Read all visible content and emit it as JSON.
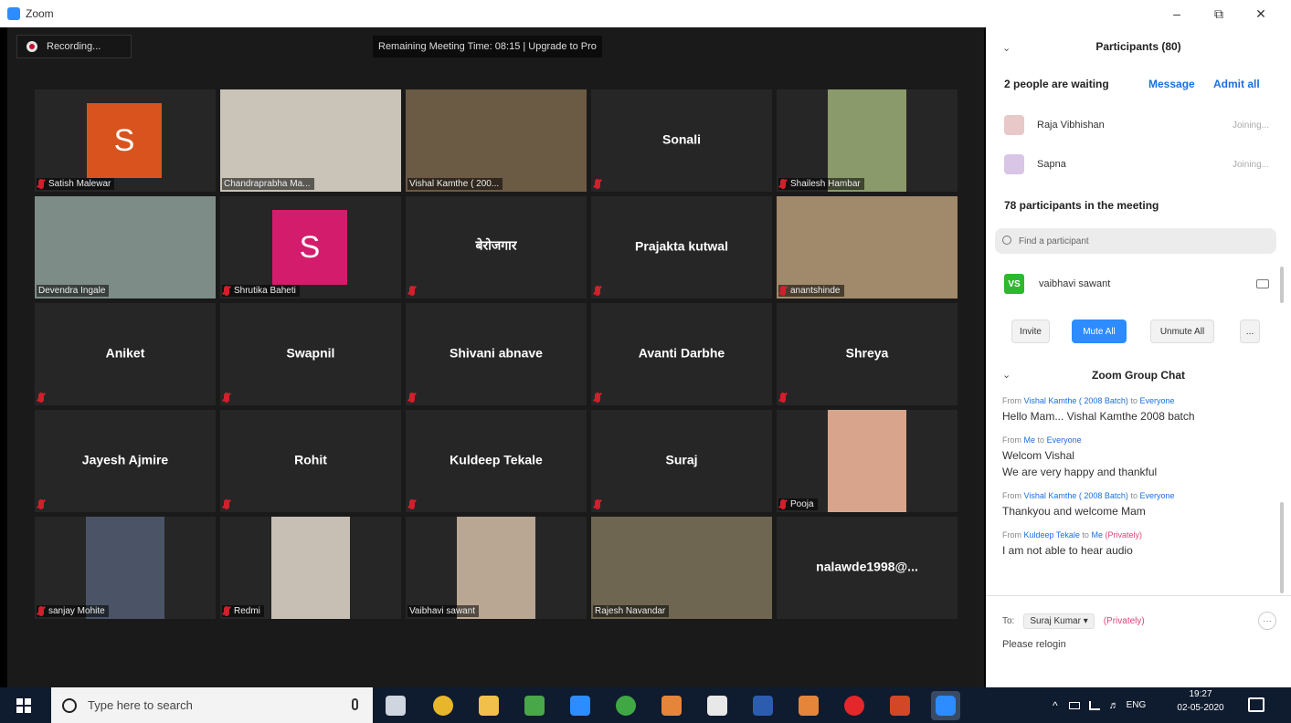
{
  "window": {
    "title": "Zoom",
    "minimize": "–",
    "restore": "⧉",
    "close": "✕"
  },
  "meeting": {
    "recording_label": "Recording...",
    "remaining_time_text": "Remaining Meeting Time: 08:15 | Upgrade to Pro"
  },
  "tiles": [
    {
      "name": "Satish Malewar",
      "type": "avatar",
      "letter": "S",
      "avatar_color": "#d9531e",
      "muted": true
    },
    {
      "name": "Chandraprabha Ma...",
      "type": "photo",
      "photo_color": "#c9c3b8",
      "muted": false
    },
    {
      "name": "Vishal Kamthe ( 200...",
      "type": "photo",
      "photo_color": "#6b5a44",
      "muted": false,
      "active_speaker": true
    },
    {
      "name": "Sonali",
      "type": "name",
      "muted": true
    },
    {
      "name": "Shailesh Hambar",
      "type": "photo",
      "photo_color": "#8a9a6a",
      "muted": true
    },
    {
      "name": "Devendra Ingale",
      "type": "photo",
      "photo_color": "#7d8c86",
      "muted": false
    },
    {
      "name": "Shrutika Baheti",
      "type": "avatar",
      "letter": "S",
      "avatar_color": "#d31d6c",
      "muted": true
    },
    {
      "name": "बेरोजगार",
      "type": "name",
      "muted": true
    },
    {
      "name": "Prajakta kutwal",
      "type": "name",
      "muted": true
    },
    {
      "name": "anantshinde",
      "type": "photo",
      "photo_color": "#a1896b",
      "muted": true
    },
    {
      "name": "Aniket",
      "type": "name",
      "muted": true
    },
    {
      "name": "Swapnil",
      "type": "name",
      "muted": true
    },
    {
      "name": "Shivani abnave",
      "type": "name",
      "muted": true
    },
    {
      "name": "Avanti Darbhe",
      "type": "name",
      "muted": true
    },
    {
      "name": "Shreya",
      "type": "name",
      "muted": true
    },
    {
      "name": "Jayesh Ajmire",
      "type": "name",
      "muted": true
    },
    {
      "name": "Rohit",
      "type": "name",
      "muted": true
    },
    {
      "name": "Kuldeep Tekale",
      "type": "name",
      "muted": true
    },
    {
      "name": "Suraj",
      "type": "name",
      "muted": true
    },
    {
      "name": "Pooja",
      "type": "photo",
      "photo_color": "#d8a58c",
      "muted": true
    },
    {
      "name": "sanjay Mohite",
      "type": "photo",
      "photo_color": "#4a5466",
      "muted": true
    },
    {
      "name": "Redmi",
      "type": "photo",
      "photo_color": "#c7bfb3",
      "muted": true
    },
    {
      "name": "Vaibhavi sawant",
      "type": "photo",
      "photo_color": "#b9a693",
      "muted": false
    },
    {
      "name": "Rajesh Navandar",
      "type": "photo",
      "photo_color": "#6e6650",
      "muted": false
    },
    {
      "name": "nalawde1998@...",
      "type": "name",
      "muted": false
    }
  ],
  "participants_panel": {
    "title": "Participants (80)",
    "waiting_title": "2 people are waiting",
    "message_label": "Message",
    "admit_all_label": "Admit all",
    "waiting": [
      {
        "name": "Raja Vibhishan",
        "status": "Joining...",
        "avatar_color": "#e8c8c8"
      },
      {
        "name": "Sapna",
        "status": "Joining...",
        "avatar_color": "#d9c6e6"
      }
    ],
    "in_meeting_title": "78 participants in the meeting",
    "search_placeholder": "Find a participant",
    "participant": {
      "initials": "VS",
      "name": "vaibhavi sawant"
    },
    "invite_label": "Invite",
    "mute_all_label": "Mute All",
    "unmute_all_label": "Unmute All",
    "more_label": "..."
  },
  "chat": {
    "title": "Zoom Group Chat",
    "messages": [
      {
        "from": "Vishal Kamthe ( 2008 Batch)",
        "to": "Everyone",
        "private": "",
        "lines": [
          "Hello Mam... Vishal Kamthe 2008 batch"
        ]
      },
      {
        "from": "Me",
        "to": "Everyone",
        "private": "",
        "lines": [
          "Welcom Vishal",
          "We are very happy and thankful"
        ]
      },
      {
        "from": "Vishal Kamthe ( 2008 Batch)",
        "to": "Everyone",
        "private": "",
        "lines": [
          "Thankyou and welcome Mam"
        ]
      },
      {
        "from": "Kuldeep Tekale",
        "to": "Me",
        "private": "(Privately)",
        "lines": [
          "I am not able to hear audio"
        ]
      }
    ],
    "from_word": "From",
    "to_word": "to",
    "to_label": "To:",
    "recipient": "Suraj Kumar ▾",
    "recipient_private": "(Privately)",
    "compose_text": "Please relogin",
    "more": "···"
  },
  "taskbar": {
    "search_placeholder": "Type here to search",
    "language": "ENG",
    "time": "19:27",
    "date": "02-05-2020",
    "icons": [
      "task-view-icon",
      "chrome-icon",
      "file-explorer-icon",
      "photos-icon",
      "edge-icon",
      "whatsapp-icon",
      "matlab-icon",
      "mail-icon",
      "word-icon",
      "matlab2-icon",
      "opera-icon",
      "powerpoint-icon",
      "zoom-icon"
    ],
    "icon_colors": [
      "#cfd6e0",
      "#e7b62a",
      "#f0c04a",
      "#48a748",
      "#2d8cff",
      "#3fa844",
      "#e4853a",
      "#e8e8e8",
      "#2b5cae",
      "#e4853a",
      "#e3272a",
      "#d24726",
      "#2d8cff"
    ]
  }
}
